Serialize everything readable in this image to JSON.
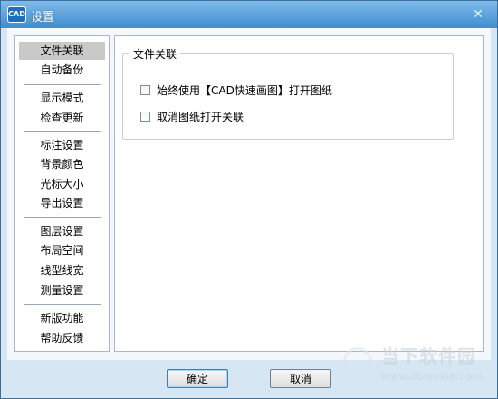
{
  "window": {
    "title": "设置",
    "logo_text": "CAD",
    "close_symbol": "✕"
  },
  "sidebar": {
    "items": [
      {
        "label": "文件关联",
        "active": true
      },
      {
        "label": "自动备份"
      },
      {
        "label": "显示模式"
      },
      {
        "label": "检查更新"
      },
      {
        "label": "标注设置"
      },
      {
        "label": "背景颜色"
      },
      {
        "label": "光标大小"
      },
      {
        "label": "导出设置"
      },
      {
        "label": "图层设置"
      },
      {
        "label": "布局空间"
      },
      {
        "label": "线型线宽"
      },
      {
        "label": "测量设置"
      },
      {
        "label": "新版功能"
      },
      {
        "label": "帮助反馈"
      }
    ]
  },
  "content": {
    "group_title": "文件关联",
    "options": [
      {
        "label": "始终使用【CAD快速画图】打开图纸",
        "checked": false
      },
      {
        "label": "取消图纸打开关联",
        "checked": false
      }
    ]
  },
  "footer": {
    "ok_label": "确定",
    "cancel_label": "取消"
  },
  "watermark": {
    "name": "当下软件园",
    "url": "www.downxia.com"
  },
  "colors": {
    "titlebar": "#3f8dd0",
    "active_item": "#c9c9c9",
    "panel_border": "#a7b7c7"
  }
}
